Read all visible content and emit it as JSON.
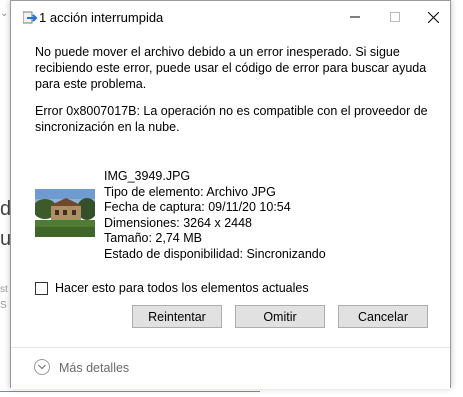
{
  "dialog": {
    "title": "1 acción interrumpida",
    "message": "No puede mover el archivo debido a un error inesperado. Si sigue recibiendo este error, puede usar el código de error para buscar ayuda para este problema.",
    "error_detail": "Error 0x8007017B: La operación no es compatible con el proveedor de sincronización en la nube."
  },
  "file": {
    "name": "IMG_3949.JPG",
    "type": "Tipo de elemento: Archivo JPG",
    "date": "Fecha de captura: 09/11/20 10:54",
    "dimensions": "Dimensiones: 3264 x 2448",
    "size": "Tamaño: 2,74 MB",
    "status": "Estado de disponibilidad: Sincronizando"
  },
  "checkbox": {
    "label": "Hacer esto para todos los elementos actuales",
    "checked": false
  },
  "buttons": {
    "retry": "Reintentar",
    "skip": "Omitir",
    "cancel": "Cancelar"
  },
  "footer": {
    "more_details": "Más detalles"
  },
  "background": {
    "text_top": "d",
    "text_bottom": "u",
    "small1": "st",
    "small2": "S"
  }
}
